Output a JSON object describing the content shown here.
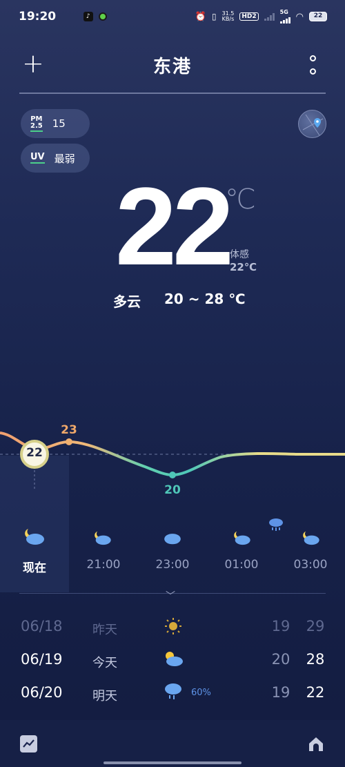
{
  "status_bar": {
    "time": "19:20",
    "net_speed_value": "31.5",
    "net_speed_unit": "KB/s",
    "hd_label": "HD2",
    "network_label": "5G",
    "battery": "22"
  },
  "header": {
    "city": "东港"
  },
  "air": {
    "pm_label_top": "PM",
    "pm_label_bottom": "2.5",
    "pm_value": "15",
    "uv_label": "UV",
    "uv_value": "最弱"
  },
  "current": {
    "temp": "22",
    "unit": "℃",
    "feels_label": "体感",
    "feels_value": "22℃",
    "condition": "多云",
    "range": "20 ~ 28 ℃"
  },
  "hourly_chart": {
    "current_marker": "22",
    "high_label": "23",
    "low_label": "20"
  },
  "hourly": [
    {
      "label": "现在",
      "icon": "partly-cloudy-night-icon"
    },
    {
      "label": "21:00",
      "icon": "partly-cloudy-night-icon"
    },
    {
      "label": "23:00",
      "icon": "cloudy-icon"
    },
    {
      "label": "01:00",
      "icon": "partly-cloudy-night-icon"
    },
    {
      "label": "03:00",
      "icon": "partly-cloudy-night-icon"
    }
  ],
  "daily": [
    {
      "date": "06/18",
      "name": "昨天",
      "icon": "sunny-icon",
      "pop": "",
      "low": "19",
      "high": "29"
    },
    {
      "date": "06/19",
      "name": "今天",
      "icon": "partly-cloudy-icon",
      "pop": "",
      "low": "20",
      "high": "28"
    },
    {
      "date": "06/20",
      "name": "明天",
      "icon": "rain-icon",
      "pop": "60%",
      "low": "19",
      "high": "22"
    }
  ],
  "colors": {
    "accent_green": "#4cd08a",
    "warm": "#f0a86a",
    "cool": "#4fc7b8",
    "rain_blue": "#5e93e6"
  }
}
